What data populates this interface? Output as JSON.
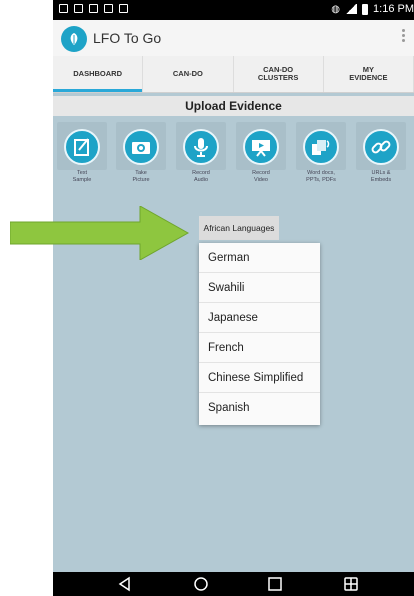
{
  "status_bar": {
    "time": "1:16 PM"
  },
  "app": {
    "title": "LFO To Go"
  },
  "tabs": [
    {
      "label": "DASHBOARD"
    },
    {
      "label": "CAN-DO"
    },
    {
      "label": "CAN-DO\nCLUSTERS"
    },
    {
      "label": "MY\nEVIDENCE"
    }
  ],
  "section": {
    "title": "Upload Evidence"
  },
  "upload_options": [
    {
      "label": "Text\nSample",
      "icon": "text-sample-icon"
    },
    {
      "label": "Take\nPicture",
      "icon": "camera-icon"
    },
    {
      "label": "Record\nAudio",
      "icon": "microphone-icon"
    },
    {
      "label": "Record\nVideo",
      "icon": "video-camera-icon"
    },
    {
      "label": "Word docs,\nPPTs, PDFs",
      "icon": "documents-icon"
    },
    {
      "label": "URLs &\nEmbeds",
      "icon": "link-icon"
    }
  ],
  "language_dropdown": {
    "selected": "African Languages",
    "options": [
      "German",
      "Swahili",
      "Japanese",
      "French",
      "Chinese Simplified",
      "Spanish"
    ]
  },
  "colors": {
    "accent": "#1ea3c7",
    "arrow": "#8ec63f",
    "background": "#b3c9d3"
  }
}
